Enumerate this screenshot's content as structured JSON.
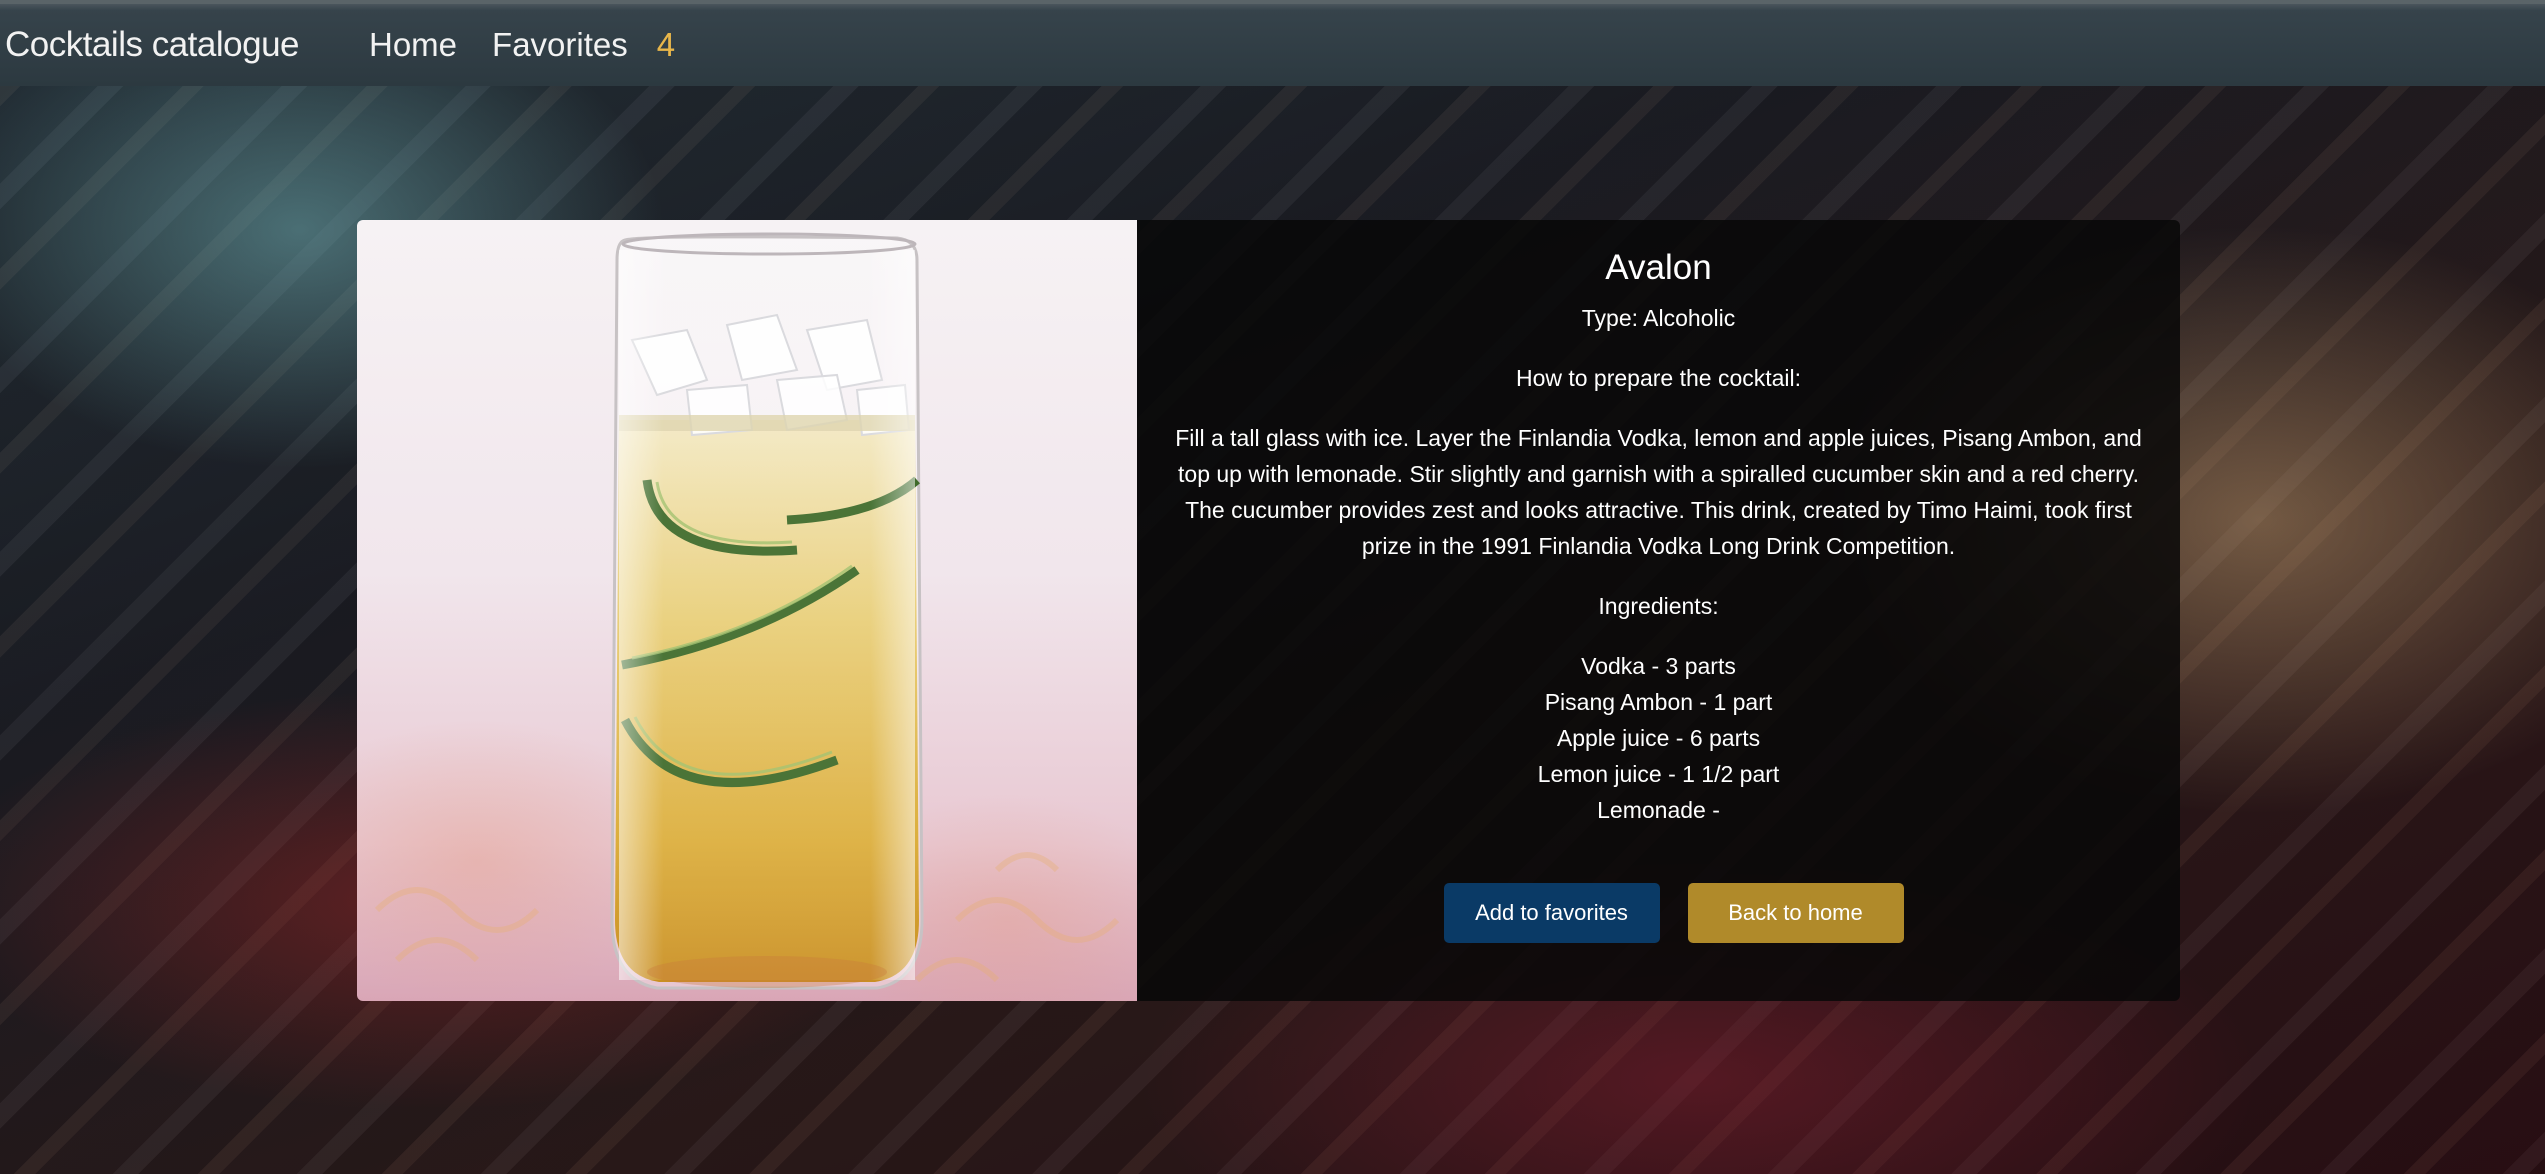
{
  "navbar": {
    "brand": "Cocktails catalogue",
    "home_label": "Home",
    "favorites_label": "Favorites",
    "favorites_count": "4"
  },
  "cocktail": {
    "name": "Avalon",
    "type_line": "Type: Alcoholic",
    "prepare_heading": "How to prepare the cocktail:",
    "instructions": "Fill a tall glass with ice. Layer the Finlandia Vodka, lemon and apple juices, Pisang Ambon, and top up with lemonade. Stir slightly and garnish with a spiralled cucumber skin and a red cherry. The cucumber provides zest and looks attractive. This drink, created by Timo Haimi, took first prize in the 1991 Finlandia Vodka Long Drink Competition.",
    "ingredients_heading": "Ingredients:",
    "ingredients": [
      "Vodka - 3 parts",
      "Pisang Ambon - 1 part",
      "Apple juice - 6 parts",
      "Lemon juice - 1 1/2 part",
      "Lemonade -"
    ]
  },
  "actions": {
    "add_favorites_label": "Add to favorites",
    "back_home_label": "Back to home"
  },
  "colors": {
    "accent_count": "#e8b64a",
    "favorites_button": "#0a3a66",
    "home_button": "#b08a2a"
  }
}
